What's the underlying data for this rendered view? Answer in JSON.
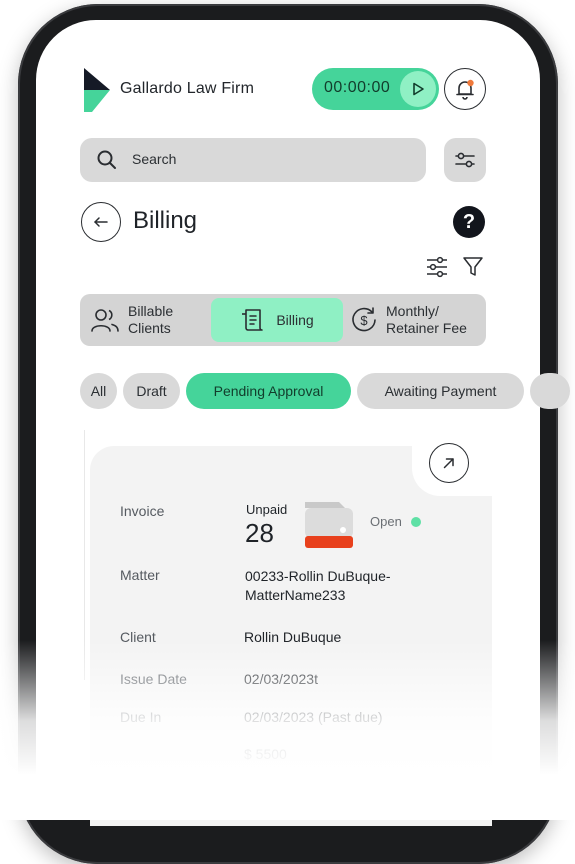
{
  "header": {
    "firm_name": "Gallardo Law Firm",
    "timer": "00:00:00"
  },
  "search": {
    "placeholder": "Search"
  },
  "page": {
    "title": "Billing",
    "help": "?"
  },
  "segments": {
    "billable_clients_line1": "Billable",
    "billable_clients_line2": "Clients",
    "billing": "Billing",
    "monthly_line1": "Monthly/",
    "monthly_line2": "Retainer Fee"
  },
  "chips": {
    "all": "All",
    "draft": "Draft",
    "pending": "Pending Approval",
    "awaiting": "Awaiting Payment"
  },
  "invoice": {
    "invoice_label": "Invoice",
    "unpaid_label": "Unpaid",
    "unpaid_count": "28",
    "status": "Open",
    "matter_label": "Matter",
    "matter_line1": "00233-Rollin DuBuque-",
    "matter_line2": "MatterName233",
    "client_label": "Client",
    "client_value": "Rollin DuBuque",
    "issue_label": "Issue Date",
    "issue_value": "02/03/2023t",
    "due_label": "Due In",
    "due_value": "02/03/2023 (Past due)",
    "amount_value": "$ 5500"
  },
  "colors": {
    "accent_green": "#45d49a",
    "accent_light_green": "#8ff0c4",
    "unpaid_bar_red": "#e8401c",
    "frame": "#1b1c1e"
  }
}
